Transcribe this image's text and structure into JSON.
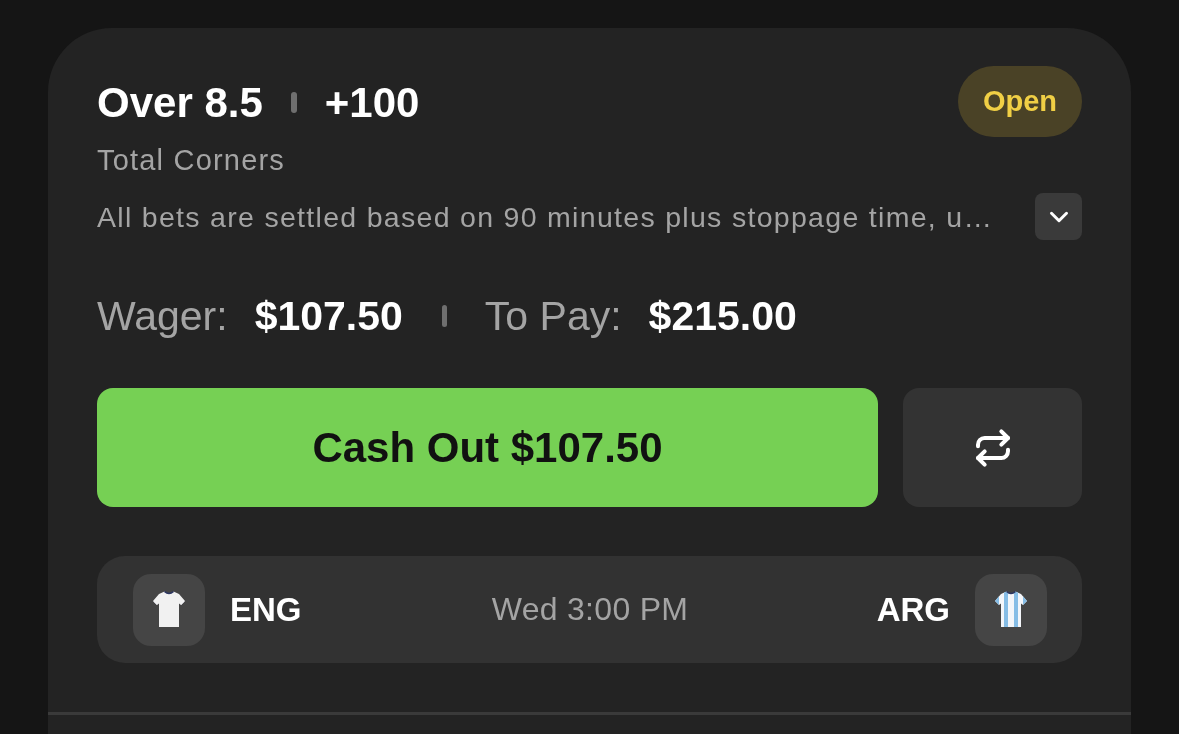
{
  "bet": {
    "selection": "Over 8.5",
    "odds": "+100",
    "status": {
      "label": "Open",
      "kind": "open"
    },
    "market": "Total Corners",
    "rules": {
      "text": "All bets are settled based on 90 minutes plus stoppage time, u…",
      "expanded": false
    }
  },
  "amounts": [
    {
      "label": "Wager:",
      "value": "$107.50"
    },
    {
      "label": "To Pay:",
      "value": "$215.00"
    }
  ],
  "actions": {
    "cash_out": "Cash Out $107.50"
  },
  "match": {
    "home": {
      "code": "ENG",
      "kind": "plain"
    },
    "time": "Wed 3:00 PM",
    "away": {
      "code": "ARG",
      "kind": "striped"
    }
  }
}
